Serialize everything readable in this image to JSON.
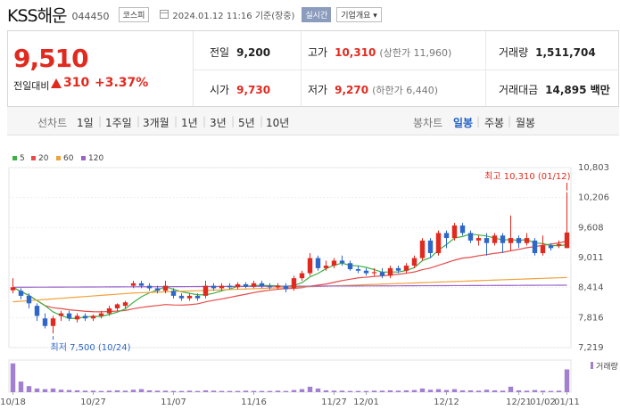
{
  "header": {
    "company": "KSS해운",
    "code": "044450",
    "market": "코스피",
    "datetime": "2024.01.12 11:16 기준(장중)",
    "realtime_label": "실시간",
    "info_label": "기업개요"
  },
  "price": {
    "current": "9,510",
    "compare_label": "전일대비",
    "change": "310",
    "change_pct": "+3.37%"
  },
  "stats": {
    "prev_label": "전일",
    "prev": "9,200",
    "high_label": "고가",
    "high": "10,310",
    "upper_limit": "(상한가 11,960)",
    "volume_label": "거래량",
    "volume": "1,511,704",
    "open_label": "시가",
    "open": "9,730",
    "low_label": "저가",
    "low": "9,270",
    "lower_limit": "(하한가 6,440)",
    "amount_label": "거래대금",
    "amount": "14,895 백만"
  },
  "tabs": {
    "line_label": "선차트",
    "periods": [
      "1일",
      "1주일",
      "3개월",
      "1년",
      "3년",
      "5년",
      "10년"
    ],
    "candle_label": "봉차트",
    "candles": [
      "일봉",
      "주봉",
      "월봉"
    ],
    "selected_candle": "일봉"
  },
  "colors": {
    "up": "#e12a1f",
    "down": "#2f67c8",
    "ma5": "#3cb043",
    "ma20": "#e54b4b",
    "ma60": "#f0a23a",
    "ma120": "#9a63c9"
  },
  "chart_data": {
    "type": "candlestick",
    "legend": [
      {
        "name": "5",
        "color": "#3cb043"
      },
      {
        "name": "20",
        "color": "#e54b4b"
      },
      {
        "name": "60",
        "color": "#f0a23a"
      },
      {
        "name": "120",
        "color": "#9a63c9"
      }
    ],
    "y_ticks": [
      "10,803",
      "10,206",
      "9,608",
      "9,011",
      "8,414",
      "7,816",
      "7,219"
    ],
    "ylim": [
      7219,
      10803
    ],
    "x_ticks": [
      "10/18",
      "10/27",
      "11/07",
      "11/16",
      "11/27",
      "12/01",
      "12/12",
      "12/21",
      "01/02",
      "01/11"
    ],
    "max_label": "최고 10,310 (01/12)",
    "min_label": "최저 7,500 (10/24)",
    "volume_label": "거래량",
    "candles": [
      [
        8360,
        8420,
        8300,
        8600
      ],
      [
        8350,
        8250,
        8180,
        8400
      ],
      [
        8250,
        8100,
        8000,
        8300
      ],
      [
        8050,
        7850,
        7750,
        8100
      ],
      [
        7800,
        7650,
        7600,
        7900
      ],
      [
        7650,
        7800,
        7500,
        7850
      ],
      [
        7850,
        7900,
        7750,
        7950
      ],
      [
        7900,
        7800,
        7750,
        7950
      ],
      [
        7780,
        7850,
        7720,
        7900
      ],
      [
        7850,
        7800,
        7750,
        7900
      ],
      [
        7800,
        7850,
        7750,
        7880
      ],
      [
        7850,
        7900,
        7800,
        7950
      ],
      [
        7900,
        8000,
        7850,
        8050
      ],
      [
        8000,
        8080,
        7950,
        8100
      ],
      [
        8050,
        8120,
        8000,
        8150
      ],
      [
        8450,
        8500,
        8400,
        8550
      ],
      [
        8500,
        8450,
        8400,
        8550
      ],
      [
        8450,
        8400,
        8350,
        8500
      ],
      [
        8400,
        8350,
        8300,
        8450
      ],
      [
        8350,
        8450,
        8300,
        8550
      ],
      [
        8350,
        8250,
        8200,
        8400
      ],
      [
        8250,
        8200,
        8150,
        8300
      ],
      [
        8200,
        8250,
        8150,
        8300
      ],
      [
        8250,
        8200,
        8150,
        8300
      ],
      [
        8250,
        8450,
        8200,
        8550
      ],
      [
        8450,
        8400,
        8350,
        8500
      ],
      [
        8400,
        8450,
        8350,
        8500
      ],
      [
        8450,
        8420,
        8380,
        8500
      ],
      [
        8420,
        8480,
        8380,
        8520
      ],
      [
        8480,
        8430,
        8400,
        8520
      ],
      [
        8430,
        8500,
        8400,
        8550
      ],
      [
        8500,
        8440,
        8400,
        8550
      ],
      [
        8440,
        8420,
        8380,
        8500
      ],
      [
        8420,
        8450,
        8380,
        8500
      ],
      [
        8450,
        8380,
        8320,
        8500
      ],
      [
        8400,
        8600,
        8350,
        8650
      ],
      [
        8600,
        8700,
        8550,
        8750
      ],
      [
        8700,
        9000,
        8650,
        9100
      ],
      [
        9000,
        8800,
        8750,
        9050
      ],
      [
        8800,
        8850,
        8750,
        8950
      ],
      [
        8850,
        8950,
        8800,
        9000
      ],
      [
        8950,
        8900,
        8850,
        9050
      ],
      [
        8900,
        8780,
        8750,
        8950
      ],
      [
        8780,
        8750,
        8700,
        8850
      ],
      [
        8750,
        8700,
        8650,
        8800
      ],
      [
        8700,
        8720,
        8650,
        8800
      ],
      [
        8720,
        8650,
        8600,
        8800
      ],
      [
        8650,
        8800,
        8600,
        8850
      ],
      [
        8800,
        8750,
        8700,
        8850
      ],
      [
        8750,
        8850,
        8700,
        8900
      ],
      [
        8850,
        9000,
        8800,
        9050
      ],
      [
        9000,
        9350,
        8950,
        9400
      ],
      [
        9350,
        9100,
        9000,
        9400
      ],
      [
        9100,
        9500,
        9050,
        9550
      ],
      [
        9500,
        9400,
        9200,
        9550
      ],
      [
        9400,
        9650,
        9350,
        9700
      ],
      [
        9650,
        9500,
        9450,
        9700
      ],
      [
        9500,
        9350,
        9300,
        9550
      ],
      [
        9350,
        9400,
        9250,
        9450
      ],
      [
        9400,
        9300,
        9050,
        9500
      ],
      [
        9300,
        9450,
        9250,
        9500
      ],
      [
        9450,
        9300,
        9100,
        9500
      ],
      [
        9300,
        9400,
        9150,
        9850
      ],
      [
        9400,
        9300,
        9200,
        9450
      ],
      [
        9300,
        9400,
        9250,
        9500
      ],
      [
        9350,
        9100,
        9050,
        9400
      ],
      [
        9100,
        9250,
        9050,
        9450
      ],
      [
        9250,
        9200,
        9150,
        9300
      ],
      [
        9250,
        9280,
        9200,
        9350
      ],
      [
        9200,
        9510,
        9200,
        10310
      ]
    ],
    "volumes": [
      0.95,
      0.35,
      0.2,
      0.12,
      0.1,
      0.12,
      0.08,
      0.07,
      0.06,
      0.05,
      0.05,
      0.04,
      0.05,
      0.06,
      0.05,
      0.08,
      0.1,
      0.06,
      0.05,
      0.05,
      0.04,
      0.04,
      0.05,
      0.04,
      0.06,
      0.05,
      0.04,
      0.04,
      0.04,
      0.05,
      0.04,
      0.04,
      0.04,
      0.05,
      0.04,
      0.07,
      0.1,
      0.18,
      0.12,
      0.06,
      0.05,
      0.05,
      0.04,
      0.04,
      0.04,
      0.05,
      0.05,
      0.06,
      0.05,
      0.06,
      0.07,
      0.12,
      0.08,
      0.1,
      0.07,
      0.1,
      0.06,
      0.06,
      0.05,
      0.08,
      0.06,
      0.05,
      0.18,
      0.06,
      0.05,
      0.07,
      0.05,
      0.04,
      0.05,
      0.75
    ]
  }
}
